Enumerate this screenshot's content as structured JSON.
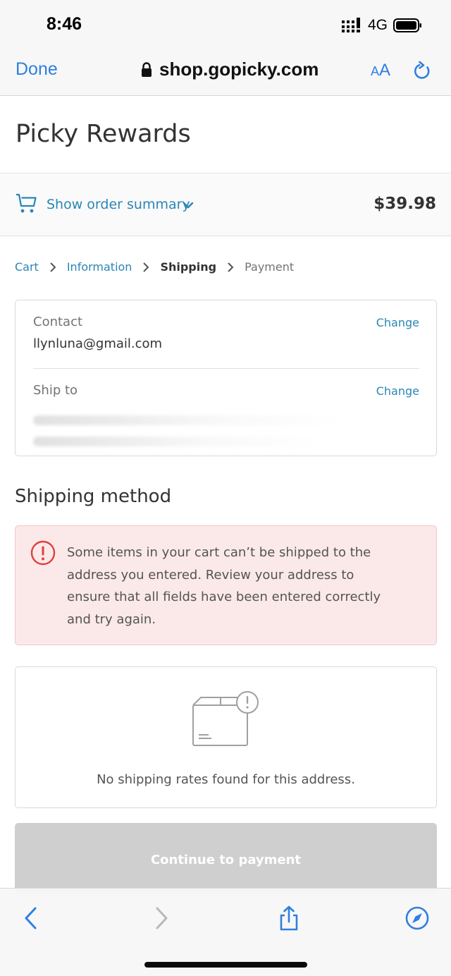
{
  "status_bar": {
    "time": "8:46",
    "network": "4G",
    "icons": [
      "signal-bars-icon",
      "battery-icon"
    ]
  },
  "browser": {
    "done_label": "Done",
    "url": "shop.gopicky.com",
    "text_size_small": "A",
    "text_size_large": "A",
    "icons": [
      "lock-icon",
      "reload-icon"
    ],
    "accent_color": "#2f7fe0"
  },
  "shop": {
    "title": "Picky Rewards"
  },
  "summary": {
    "toggle_label": "Show order summary",
    "total": "$39.98",
    "icons": [
      "cart-icon",
      "chevron-down-icon"
    ]
  },
  "breadcrumb": {
    "items": [
      {
        "label": "Cart",
        "state": "link"
      },
      {
        "label": "Information",
        "state": "link"
      },
      {
        "label": "Shipping",
        "state": "current"
      },
      {
        "label": "Payment",
        "state": "pending"
      }
    ]
  },
  "review": {
    "contact_label": "Contact",
    "contact_value": "llynluna@gmail.com",
    "ship_to_label": "Ship to",
    "change_label": "Change"
  },
  "shipping_method": {
    "title": "Shipping method",
    "error_message": "Some items in your cart can’t be shipped to the address you entered. Review your address to ensure that all fields have been entered correctly and try again.",
    "no_rates_message": "No shipping rates found for this address.",
    "icons": [
      "error-icon",
      "package-warning-icon"
    ],
    "error_color": "#e33d3d"
  },
  "continue_button": {
    "label": "Continue to payment",
    "state": "disabled"
  },
  "toolbar": {
    "icons": [
      "back-icon",
      "forward-icon",
      "share-icon",
      "compass-icon"
    ]
  },
  "link_color": "#2a86b5"
}
